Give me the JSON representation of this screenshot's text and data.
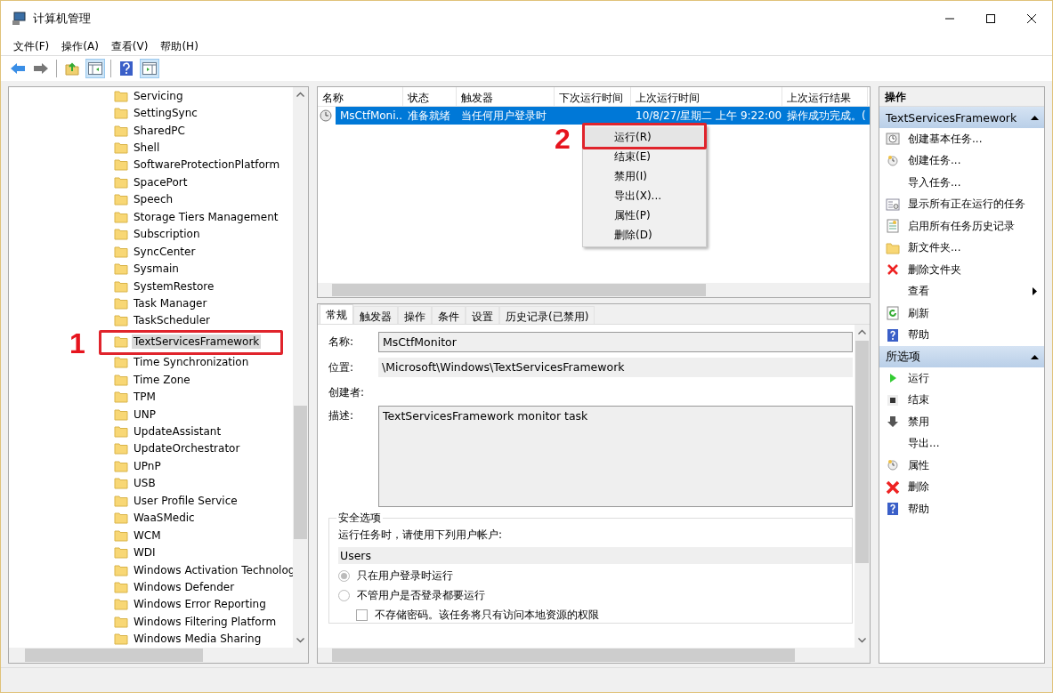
{
  "window": {
    "title": "计算机管理"
  },
  "menu": [
    "文件(F)",
    "操作(A)",
    "查看(V)",
    "帮助(H)"
  ],
  "tree": {
    "items": [
      {
        "label": "Servicing",
        "selected": false
      },
      {
        "label": "SettingSync",
        "selected": false
      },
      {
        "label": "SharedPC",
        "selected": false
      },
      {
        "label": "Shell",
        "selected": false
      },
      {
        "label": "SoftwareProtectionPlatform",
        "selected": false
      },
      {
        "label": "SpacePort",
        "selected": false
      },
      {
        "label": "Speech",
        "selected": false
      },
      {
        "label": "Storage Tiers Management",
        "selected": false
      },
      {
        "label": "Subscription",
        "selected": false
      },
      {
        "label": "SyncCenter",
        "selected": false
      },
      {
        "label": "Sysmain",
        "selected": false
      },
      {
        "label": "SystemRestore",
        "selected": false
      },
      {
        "label": "Task Manager",
        "selected": false
      },
      {
        "label": "TaskScheduler",
        "selected": false
      },
      {
        "label": "TextServicesFramework",
        "selected": true
      },
      {
        "label": "Time Synchronization",
        "selected": false
      },
      {
        "label": "Time Zone",
        "selected": false
      },
      {
        "label": "TPM",
        "selected": false
      },
      {
        "label": "UNP",
        "selected": false
      },
      {
        "label": "UpdateAssistant",
        "selected": false
      },
      {
        "label": "UpdateOrchestrator",
        "selected": false
      },
      {
        "label": "UPnP",
        "selected": false
      },
      {
        "label": "USB",
        "selected": false
      },
      {
        "label": "User Profile Service",
        "selected": false
      },
      {
        "label": "WaaSMedic",
        "selected": false
      },
      {
        "label": "WCM",
        "selected": false
      },
      {
        "label": "WDI",
        "selected": false
      },
      {
        "label": "Windows Activation Technolog",
        "selected": false
      },
      {
        "label": "Windows Defender",
        "selected": false
      },
      {
        "label": "Windows Error Reporting",
        "selected": false
      },
      {
        "label": "Windows Filtering Platform",
        "selected": false
      },
      {
        "label": "Windows Media Sharing",
        "selected": false
      }
    ]
  },
  "task_list": {
    "columns": [
      "名称",
      "状态",
      "触发器",
      "下次运行时间",
      "上次运行时间",
      "上次运行结果"
    ],
    "rows": [
      {
        "cells": [
          "MsCtfMoni...",
          "准备就绪",
          "当任何用户登录时",
          "",
          "10/8/27/星期二 上午 9:22:00",
          "操作成功完成。("
        ],
        "selected": true
      }
    ]
  },
  "context_menu": {
    "items": [
      {
        "label": "运行(R)",
        "highlighted": true
      },
      {
        "label": "结束(E)",
        "highlighted": false
      },
      {
        "label": "禁用(I)",
        "highlighted": false
      },
      {
        "label": "导出(X)...",
        "highlighted": false
      },
      {
        "label": "属性(P)",
        "highlighted": false
      },
      {
        "label": "删除(D)",
        "highlighted": false
      }
    ]
  },
  "detail": {
    "tabs": [
      {
        "label": "常规",
        "selected": true
      },
      {
        "label": "触发器",
        "selected": false
      },
      {
        "label": "操作",
        "selected": false
      },
      {
        "label": "条件",
        "selected": false
      },
      {
        "label": "设置",
        "selected": false
      },
      {
        "label": "历史记录(已禁用)",
        "selected": false
      }
    ],
    "name_label": "名称:",
    "name_value": "MsCtfMonitor",
    "location_label": "位置:",
    "location_value": "\\Microsoft\\Windows\\TextServicesFramework",
    "author_label": "创建者:",
    "description_label": "描述:",
    "description_value": "TextServicesFramework monitor task",
    "security": {
      "title": "安全选项",
      "account_prompt": "运行任务时，请使用下列用户帐户:",
      "account": "Users",
      "radios": [
        {
          "label": "只在用户登录时运行",
          "selected": true
        },
        {
          "label": "不管用户是否登录都要运行",
          "selected": false
        }
      ],
      "checkbox": {
        "label": "不存储密码。该任务将只有访问本地资源的权限",
        "checked": false
      }
    }
  },
  "actions": {
    "header": "操作",
    "sections": [
      {
        "title": "TextServicesFramework",
        "expanded": true,
        "items": [
          {
            "label": "创建基本任务...",
            "kind": "wizard"
          },
          {
            "label": "创建任务...",
            "kind": "clock"
          },
          {
            "label": "导入任务...",
            "kind": "none"
          },
          {
            "label": "显示所有正在运行的任务",
            "kind": "list"
          },
          {
            "label": "启用所有任务历史记录",
            "kind": "log"
          },
          {
            "label": "新文件夹...",
            "kind": "folder"
          },
          {
            "label": "删除文件夹",
            "kind": "delete"
          },
          {
            "label": "查看",
            "kind": "submenu"
          },
          {
            "label": "刷新",
            "kind": "refresh"
          },
          {
            "label": "帮助",
            "kind": "help"
          }
        ]
      },
      {
        "title": "所选项",
        "expanded": true,
        "items": [
          {
            "label": "运行",
            "kind": "run"
          },
          {
            "label": "结束",
            "kind": "stop"
          },
          {
            "label": "禁用",
            "kind": "disable"
          },
          {
            "label": "导出...",
            "kind": "none"
          },
          {
            "label": "属性",
            "kind": "clock"
          },
          {
            "label": "删除",
            "kind": "delete-big"
          },
          {
            "label": "帮助",
            "kind": "help"
          }
        ]
      }
    ]
  },
  "annotations": [
    "1",
    "2"
  ]
}
